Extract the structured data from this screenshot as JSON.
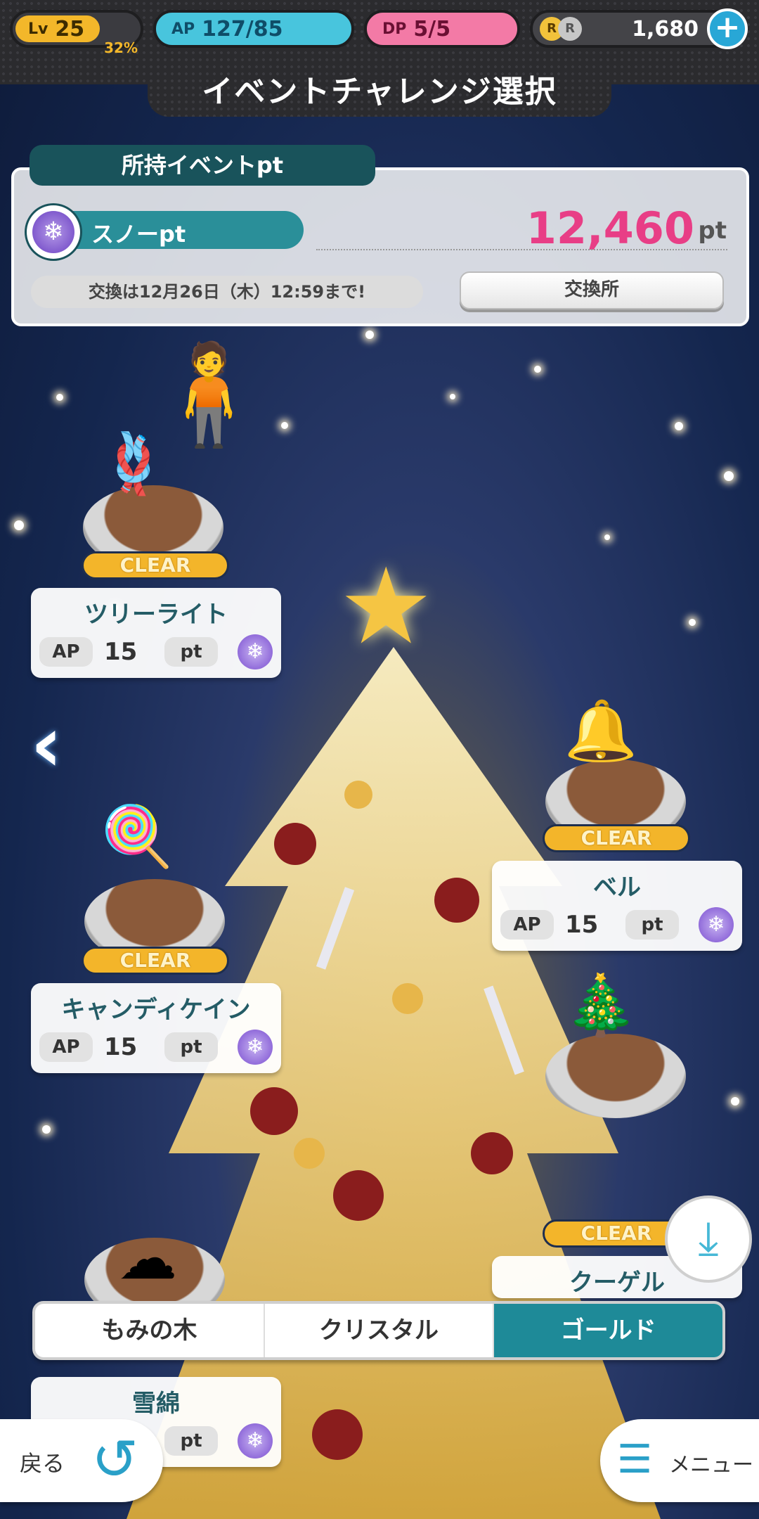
{
  "status": {
    "level_tag": "Lv",
    "level": "25",
    "level_pct": "32%",
    "ap_tag": "AP",
    "ap": "127/85",
    "dp_tag": "DP",
    "dp": "5/5",
    "coin_r": "R",
    "coin_g": "R",
    "coins": "1,680",
    "plus": "+"
  },
  "title": "イベントチャレンジ選択",
  "points": {
    "header": "所持イベントpt",
    "type_label": "スノーpt",
    "value": "12,460",
    "unit": "pt",
    "deadline": "交換は12月26日（木）12:59まで!",
    "exchange_label": "交換所"
  },
  "stages": [
    {
      "name": "ツリーライト",
      "status": "CLEAR",
      "ap_label": "AP",
      "ap": "15",
      "pt_label": "pt"
    },
    {
      "name": "ベル",
      "status": "CLEAR",
      "ap_label": "AP",
      "ap": "15",
      "pt_label": "pt"
    },
    {
      "name": "キャンディケイン",
      "status": "CLEAR",
      "ap_label": "AP",
      "ap": "15",
      "pt_label": "pt"
    },
    {
      "name": "クーゲル",
      "status": "CLEAR"
    },
    {
      "name": "雪綿",
      "pt_label": "pt"
    }
  ],
  "tabs": [
    {
      "label": "もみの木",
      "active": false
    },
    {
      "label": "クリスタル",
      "active": false
    },
    {
      "label": "ゴールド",
      "active": true
    }
  ],
  "nav": {
    "back_label": "戻る",
    "menu_label": "メニュー"
  },
  "icons": {
    "snow_point": "snowflake-icon",
    "left_arrow": "chevron-left-icon",
    "download": "download-icon",
    "back": "back-arrow-icon",
    "menu": "menu-list-icon"
  }
}
